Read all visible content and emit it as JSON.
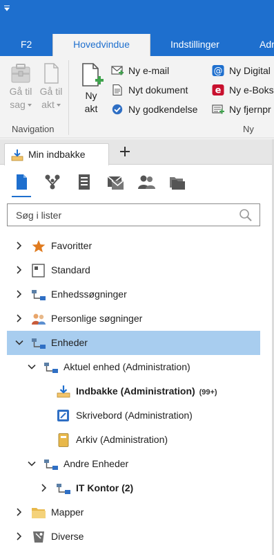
{
  "ribbon_tabs": {
    "f2": "F2",
    "main": "Hovedvindue",
    "settings": "Indstillinger",
    "partial": "Adr"
  },
  "ribbon": {
    "navigation": {
      "group_label": "Navigation",
      "goto_case_line1": "Gå til",
      "goto_case_line2": "sag",
      "goto_act_line1": "Gå til",
      "goto_act_line2": "akt"
    },
    "new": {
      "group_label": "Ny",
      "new_act_line1": "Ny",
      "new_act_line2": "akt",
      "new_email": "Ny e-mail",
      "new_document": "Nyt dokument",
      "new_approval": "Ny godkendelse",
      "new_digital": "Ny Digital",
      "new_eboks": "Ny e-Boks",
      "new_remote": "Ny fjernpr"
    }
  },
  "doc_tabs": {
    "inbox_tab": "Min indbakke"
  },
  "search": {
    "placeholder": "Søg i lister",
    "value": ""
  },
  "tree": {
    "favorites": "Favoritter",
    "standard": "Standard",
    "unit_searches": "Enhedssøgninger",
    "personal_searches": "Personlige søgninger",
    "units": "Enheder",
    "current_unit": "Aktuel enhed (Administration)",
    "inbox": "Indbakke (Administration)",
    "inbox_badge": "(99+)",
    "desk": "Skrivebord (Administration)",
    "archive": "Arkiv (Administration)",
    "other_units": "Andre Enheder",
    "it_office": "IT Kontor (2)",
    "folders": "Mapper",
    "misc": "Diverse"
  },
  "colors": {
    "accent": "#1e6fce",
    "selected_row": "#a8cdef",
    "ribbon_bg": "#f3f3f3"
  }
}
